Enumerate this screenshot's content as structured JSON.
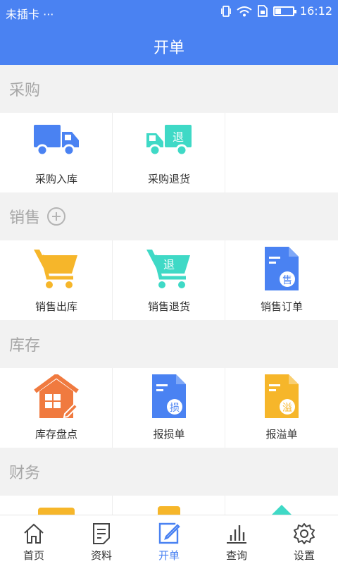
{
  "status": {
    "carrier": "未插卡",
    "dots": "···",
    "time": "16:12",
    "battery_level": 0.35
  },
  "header": {
    "title": "开单"
  },
  "sections": {
    "purchase": {
      "title": "采购",
      "items": [
        "采购入库",
        "采购退货"
      ]
    },
    "sales": {
      "title": "销售",
      "items": [
        "销售出库",
        "销售退货",
        "销售订单"
      ]
    },
    "stock": {
      "title": "库存",
      "items": [
        "库存盘点",
        "报损单",
        "报溢单"
      ]
    },
    "finance": {
      "title": "财务"
    }
  },
  "icon_text": {
    "return": "退",
    "sale": "售",
    "loss": "损",
    "overflow": "溢"
  },
  "colors": {
    "blue": "#4a82f2",
    "teal": "#3fd9c6",
    "yellow": "#f6b62a",
    "orange": "#f07a3f"
  },
  "tabs": [
    {
      "label": "首页",
      "icon": "home-icon"
    },
    {
      "label": "资料",
      "icon": "document-icon"
    },
    {
      "label": "开单",
      "icon": "edit-icon",
      "active": true
    },
    {
      "label": "查询",
      "icon": "chart-icon"
    },
    {
      "label": "设置",
      "icon": "gear-icon"
    }
  ]
}
